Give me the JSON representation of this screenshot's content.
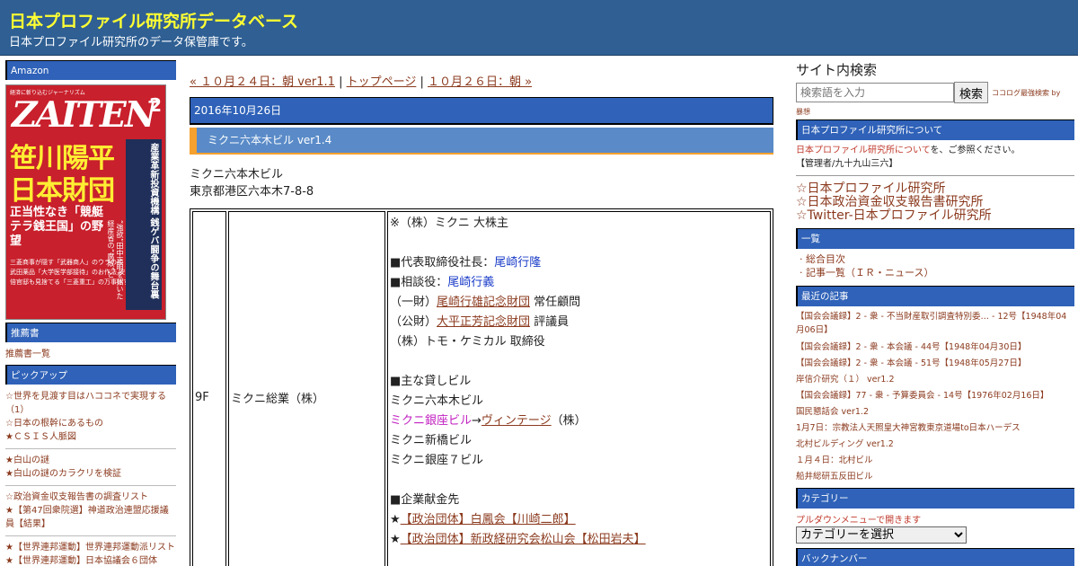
{
  "header": {
    "title": "日本プロファイル研究所データベース",
    "description": "日本プロファイル研究所のデータ保管庫です。"
  },
  "left_sidebar": {
    "amazon_heading": "Amazon",
    "book": {
      "top_text": "経済に斬り込むジャーナリズム",
      "magazine": "ZAITEN",
      "issue": "2",
      "headline1": "笹川陽平",
      "headline2": "日本財団",
      "sub": "正当性なき「競艇テラ銭王国」の野望",
      "side_headline": "産業革新投資機構 銭ゲバ闘争の舞台裏",
      "small_lines": "三菱商事が隠す「武器商人」のウラの顔 武田薬品「大学医学部接待」のお作法 安倍官邸も見捨てる「三菱重工」の万事休す",
      "vertical_small": "“強欲”田中正明を招いた経産省の“腐敗”と"
    },
    "recommend_heading": "推薦書",
    "recommend_link": "推薦書一覧",
    "pickup_heading": "ピックアップ",
    "pickup_items": [
      "☆世界を見渡す目はハココネで実現する（1）",
      "☆日本の根幹にあるもの",
      "★ＣＳＩＳ人脈図"
    ],
    "group2": [
      "★白山の謎",
      "★白山の謎のカラクリを検証"
    ],
    "group3": [
      "☆政治資金収支報告書の調査リスト",
      "★【第47回衆院選】神道政治連盟応援議員【結果】"
    ],
    "group4": [
      "★【世界連邦運動】世界連邦運動派リスト",
      "★【世界連邦運動】日本協議会６団体"
    ]
  },
  "main": {
    "nav": {
      "prev": "« １０月２４日：朝 ver1.1",
      "sep1": " | ",
      "top": "トップページ",
      "sep2": " | ",
      "next": "１０月２６日：朝 »"
    },
    "date": "2016年10月26日",
    "entry_title": "ミクニ六本木ビル ver1.4",
    "address_name": "ミクニ六本木ビル",
    "address": "東京都港区六本木7-8-8",
    "table": {
      "floor": "9F",
      "tenant": "ミクニ総業（株）",
      "note_main_shareholder": "※（株）ミクニ 大株主",
      "ceo_label": "■代表取締役社長：",
      "ceo_name": "尾崎行隆",
      "advisor_label": "■相談役：",
      "advisor_name": "尾崎行義",
      "role1_prefix": "（一財）",
      "role1_link": "尾崎行雄記念財団",
      "role1_suffix": " 常任顧問",
      "role2_prefix": "（公財）",
      "role2_link": "大平正芳記念財団",
      "role2_suffix": " 評議員",
      "role3": "（株）トモ・ケミカル 取締役",
      "rent_heading": "■主な貸しビル",
      "rent1": "ミクニ六本木ビル",
      "rent2_link": "ミクニ銀座ビル",
      "rent2_arrow": "→",
      "rent2_target": "ヴィンテージ",
      "rent2_suffix": "（株）",
      "rent3": "ミクニ新橋ビル",
      "rent4": "ミクニ銀座７ビル",
      "donation_heading": "■企業献金先",
      "donation1": "【政治団体】白鳳会【川崎二郎】",
      "donation2": "【政治団体】新政経研究会松山会【松田岩夫】",
      "star": "★"
    }
  },
  "right_sidebar": {
    "search_title": "サイト内検索",
    "search_placeholder": "検索語を入力",
    "search_button": "検索",
    "search_note": "ココログ最強検索 by",
    "search_note2": "暴想",
    "about_heading": "日本プロファイル研究所について",
    "about_text_link": "日本プロファイル研究所について",
    "about_text_rest": "を、ご参照ください。",
    "admin": "【管理者/九十九山三六】",
    "big_links": [
      "☆日本プロファイル研究所",
      "☆日本政治資金収支報告書研究所",
      "☆Twitter-日本プロファイル研究所"
    ],
    "index_heading": "一覧",
    "index_items": [
      "· 総合目次",
      "· 記事一覧（ＩＲ・ニュース）"
    ],
    "recent_heading": "最近の記事",
    "recent_items": [
      "【国会会議録】2 - 衆 - 不当財産取引調査特別委… - 12号【1948年04月06日】",
      "【国会会議録】2 - 衆 - 本会議 - 44号【1948年04月30日】",
      "【国会会議録】2 - 衆 - 本会議 - 51号【1948年05月27日】",
      "岸信介研究（１） ver1.2",
      "【国会会議録】77 - 衆 - 予算委員会 - 14号【1976年02月16日】",
      "国民懇話会 ver1.2",
      "1月7日：宗教法人天照皇大神宮教東京道場to日本ハーデス",
      "北村ビルディング ver1.2",
      "１月４日：北村ビル",
      "船井総研五反田ビル"
    ],
    "category_heading": "カテゴリー",
    "category_note": "プルダウンメニューで開きます",
    "category_select": "カテゴリーを選択",
    "backnumber_heading": "バックナンバー"
  }
}
